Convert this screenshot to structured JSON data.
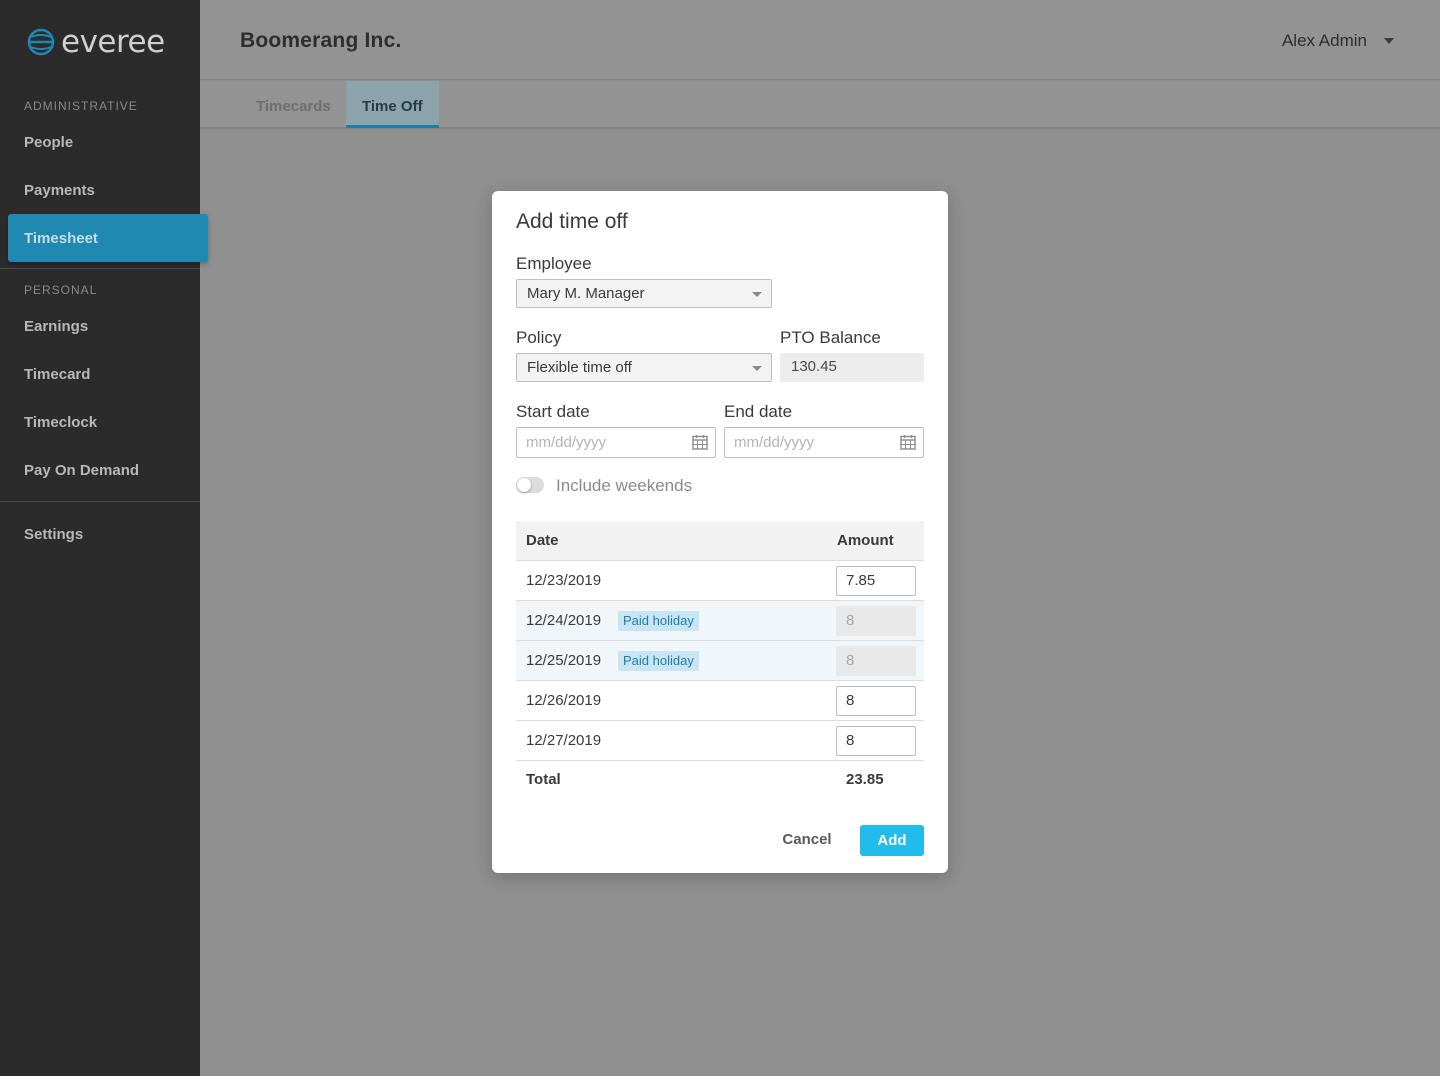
{
  "app": {
    "brand": "everee",
    "company": "Boomerang Inc.",
    "user": "Alex Admin"
  },
  "sidebar": {
    "sections": [
      {
        "label": "ADMINISTRATIVE",
        "items": [
          "People",
          "Payments",
          "Timesheet"
        ]
      },
      {
        "label": "PERSONAL",
        "items": [
          "Earnings",
          "Timecard",
          "Timeclock",
          "Pay On Demand"
        ]
      }
    ],
    "settings": "Settings",
    "active": "Timesheet"
  },
  "tabs": [
    "Timecards",
    "Time Off"
  ],
  "active_tab": "Time Off",
  "modal": {
    "title": "Add time off",
    "employee_label": "Employee",
    "employee_value": "Mary M. Manager",
    "policy_label": "Policy",
    "policy_value": "Flexible time off",
    "pto_label": "PTO Balance",
    "pto_value": "130.45",
    "start_label": "Start date",
    "start_placeholder": "mm/dd/yyyy",
    "end_label": "End date",
    "end_placeholder": "mm/dd/yyyy",
    "weekends_label": "Include weekends",
    "weekends_on": false,
    "table": {
      "headers": [
        "Date",
        "Amount"
      ],
      "rows": [
        {
          "date": "12/23/2019",
          "badge": "",
          "amount": "7.85",
          "editable": true
        },
        {
          "date": "12/24/2019",
          "badge": "Paid holiday",
          "amount": "8",
          "editable": false
        },
        {
          "date": "12/25/2019",
          "badge": "Paid holiday",
          "amount": "8",
          "editable": false
        },
        {
          "date": "12/26/2019",
          "badge": "",
          "amount": "8",
          "editable": true
        },
        {
          "date": "12/27/2019",
          "badge": "",
          "amount": "8",
          "editable": true
        }
      ],
      "total_label": "Total",
      "total_value": "23.85"
    },
    "cancel": "Cancel",
    "add": "Add"
  },
  "colors": {
    "accent": "#22bcec",
    "sidebar": "#2b2b2b",
    "active_nav": "#1f89b1",
    "badge_bg": "#c7e5f3"
  }
}
